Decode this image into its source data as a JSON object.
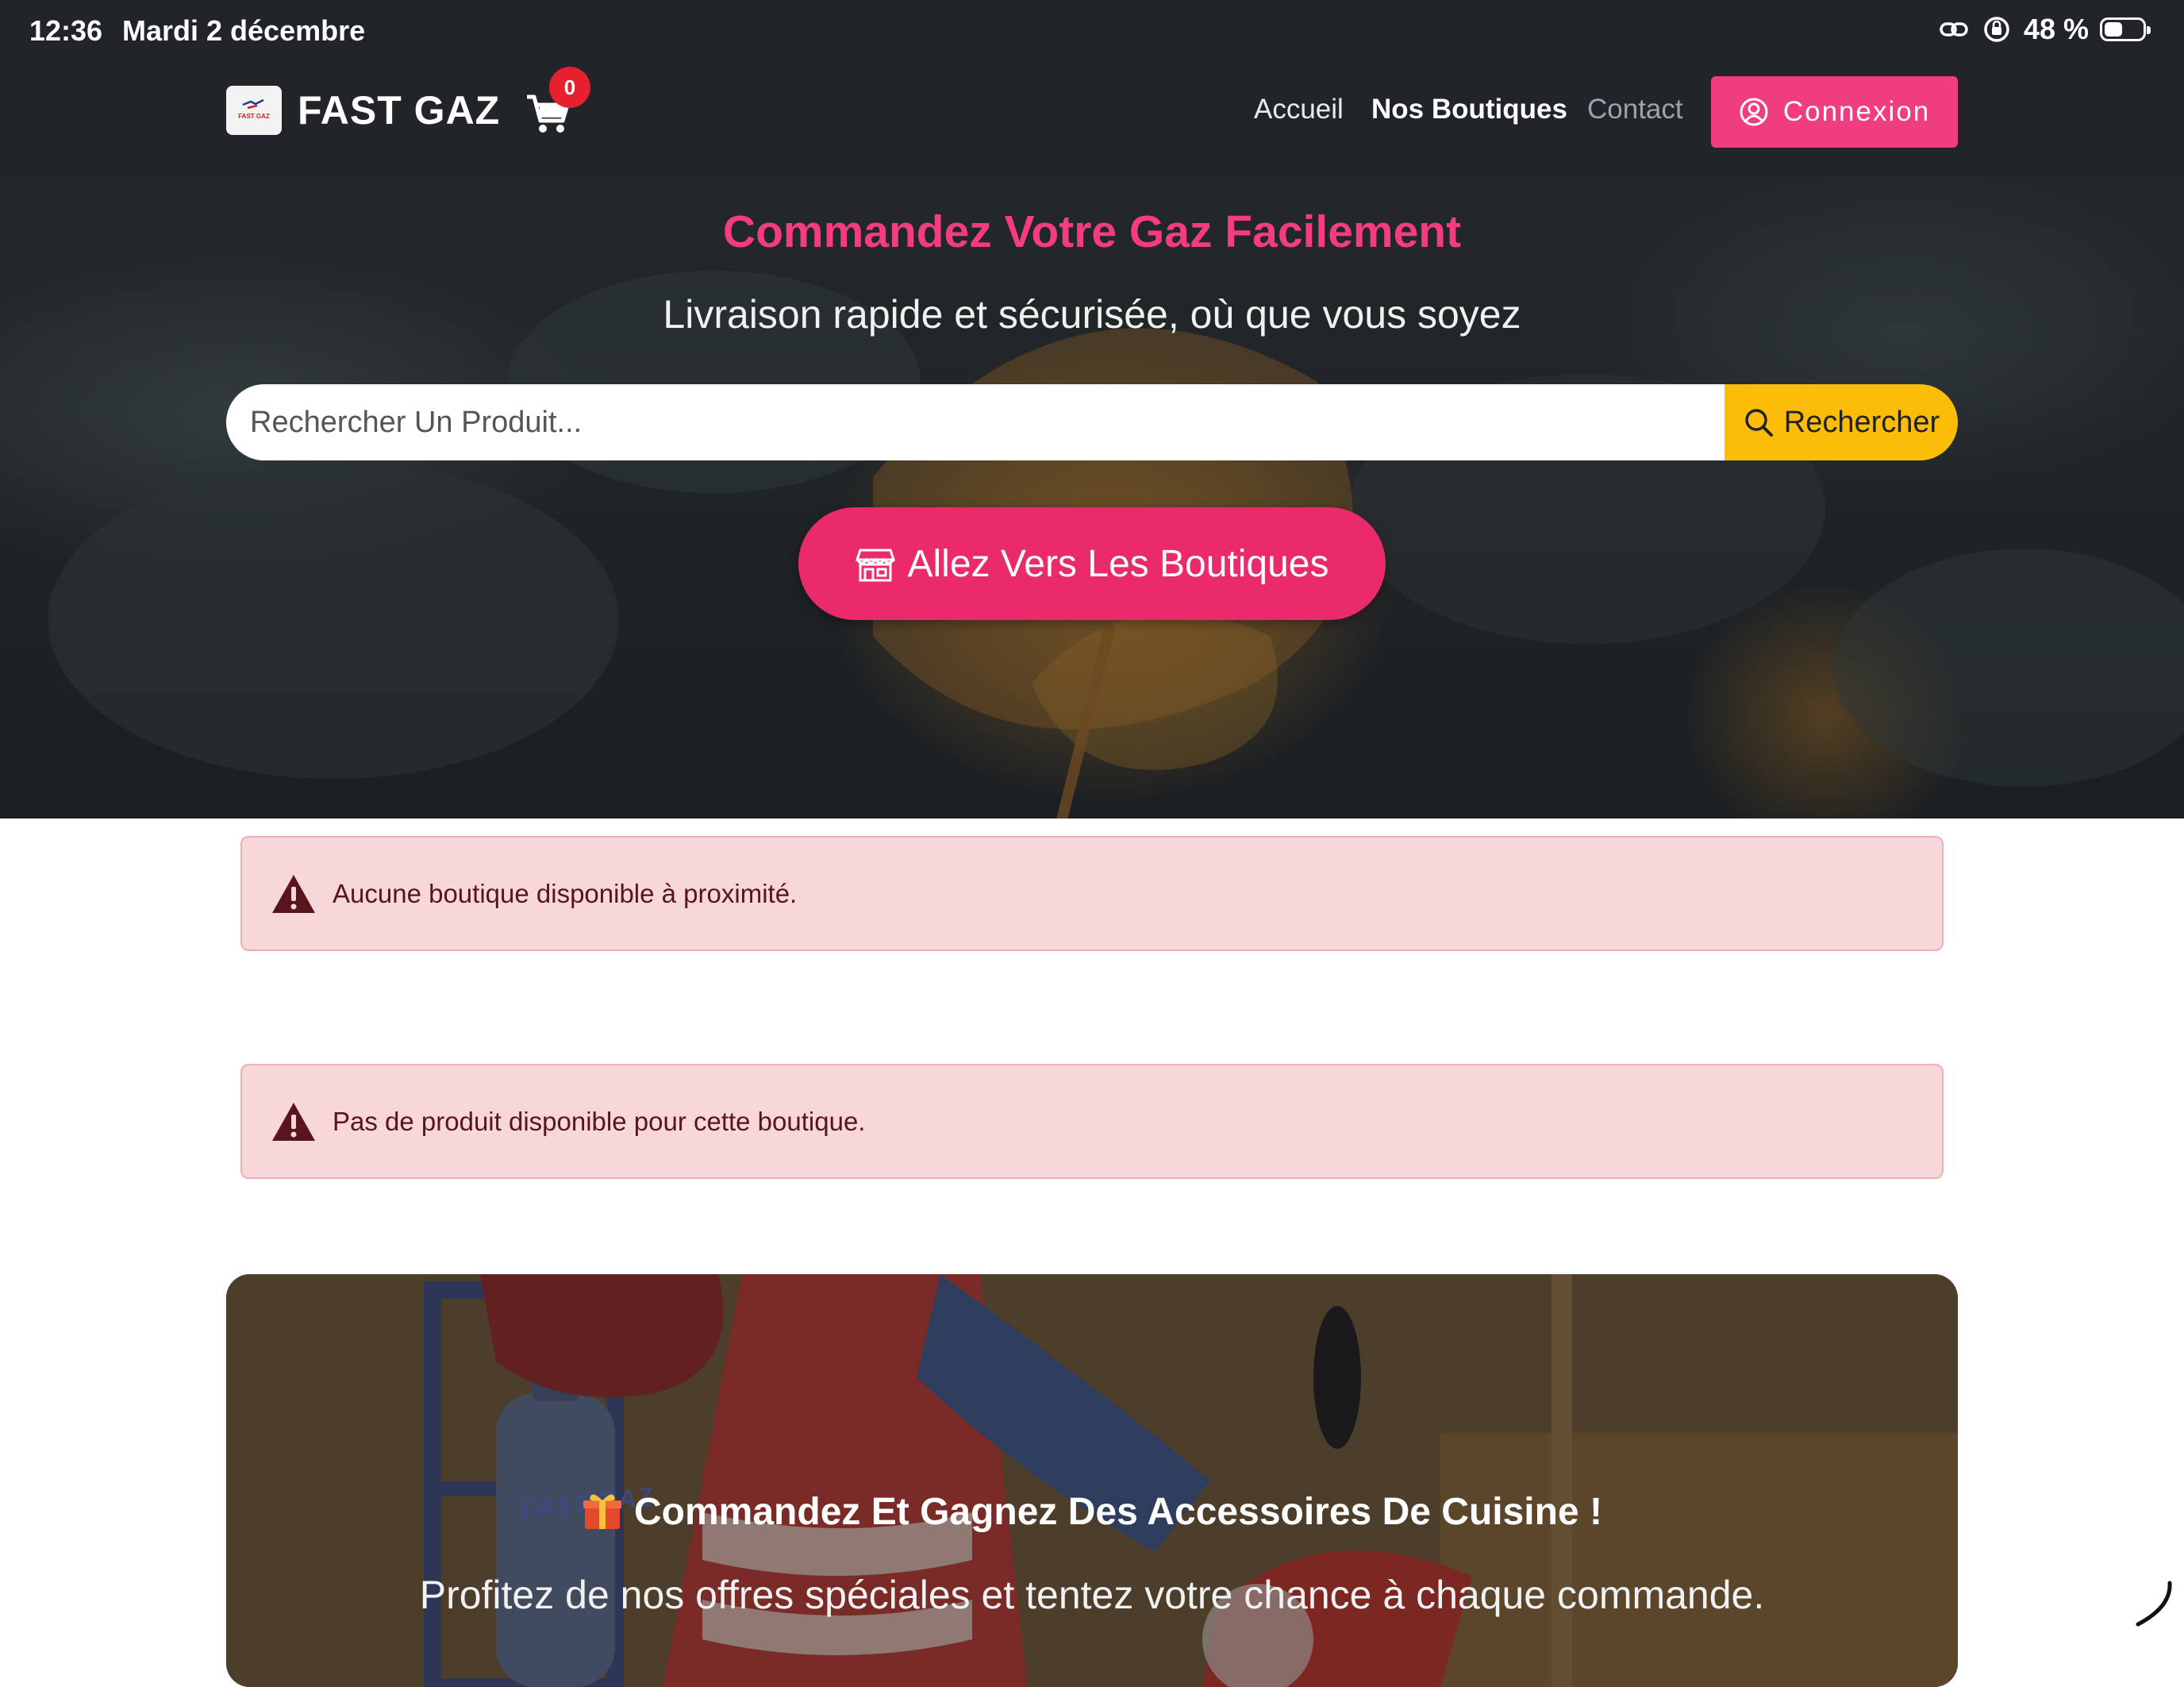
{
  "status_bar": {
    "time": "12:36",
    "date": "Mardi 2 décembre",
    "battery": "48 %",
    "battery_level": 0.48
  },
  "navbar": {
    "brand_name": "FAST GAZ",
    "logo_text": "FAST GAZ",
    "cart_count": "0",
    "links": {
      "home": "Accueil",
      "shops": "Nos Boutiques",
      "contact": "Contact"
    },
    "login_label": "Connexion"
  },
  "hero": {
    "title": "Commandez Votre Gaz Facilement",
    "subtitle": "Livraison rapide et sécurisée, où que vous soyez",
    "search": {
      "placeholder": "Rechercher Un Produit...",
      "value": "",
      "button_label": "Rechercher"
    },
    "shops_button_label": "Allez Vers Les Boutiques"
  },
  "alerts": [
    {
      "text": "Aucune boutique disponible à proximité."
    },
    {
      "text": "Pas de produit disponible pour cette boutique."
    }
  ],
  "promo": {
    "title": "Commandez Et Gagnez Des Accessoires De Cuisine !",
    "text": "Profitez de nos offres spéciales et tentez votre chance à chaque commande.",
    "illustration_text": "FAST GAZ"
  },
  "colors": {
    "nav_bg": "#212529",
    "accent_pink": "#f03d80",
    "hero_title": "#f53b82",
    "search_button": "#fbbd08",
    "alert_bg": "#f8d7da",
    "alert_text": "#58151c",
    "cart_badge": "#e6202e"
  },
  "icons": {
    "cart": "shopping-cart-icon",
    "login": "user-circle-icon",
    "search": "search-icon",
    "shops": "shop-icon",
    "alert": "warning-triangle-icon",
    "gift": "gift-icon"
  }
}
